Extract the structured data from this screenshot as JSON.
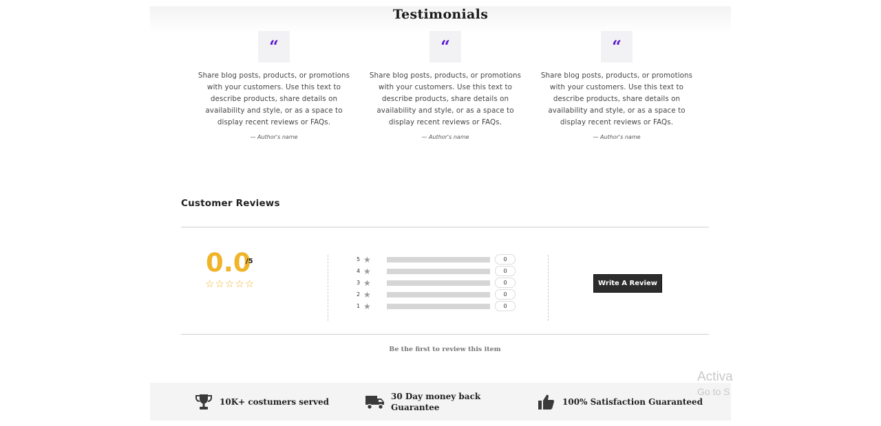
{
  "testimonials": {
    "title": "Testimonials",
    "quote_glyph": "“",
    "items": [
      {
        "text": "Share blog posts, products, or promotions with your customers. Use this text to describe products, share details on availability and style, or as a space to display recent reviews or FAQs.",
        "author": "— Author's name"
      },
      {
        "text": "Share blog posts, products, or promotions with your customers. Use this text to describe products, share details on availability and style, or as a space to display recent reviews or FAQs.",
        "author": "— Author's name"
      },
      {
        "text": "Share blog posts, products, or promotions with your customers. Use this text to describe products, share details on availability and style, or as a space to display recent reviews or FAQs.",
        "author": "— Author's name"
      }
    ]
  },
  "reviews": {
    "title": "Customer Reviews",
    "average": "0.0",
    "out_of": "/5",
    "stars": "☆☆☆☆☆",
    "star_glyph": "★",
    "breakdown": [
      {
        "stars": "5",
        "count": "0",
        "fraction": 0
      },
      {
        "stars": "4",
        "count": "0",
        "fraction": 0
      },
      {
        "stars": "3",
        "count": "0",
        "fraction": 0
      },
      {
        "stars": "2",
        "count": "0",
        "fraction": 0
      },
      {
        "stars": "1",
        "count": "0",
        "fraction": 0
      }
    ],
    "write_button": "Write A Review",
    "empty_message": "Be the first to review this item"
  },
  "guarantees": [
    {
      "icon": "trophy-icon",
      "label": "10K+ costumers served"
    },
    {
      "icon": "truck-icon",
      "label": "30 Day money back Guarantee"
    },
    {
      "icon": "thumbs-up-icon",
      "label": "100% Satisfaction Guaranteed"
    }
  ],
  "watermark": {
    "line1": "Activa",
    "line2": "Go to S"
  },
  "colors": {
    "accent_quote": "#5a16cf",
    "rating_gold": "#f0b429",
    "button_dark": "#2c2c2c"
  }
}
